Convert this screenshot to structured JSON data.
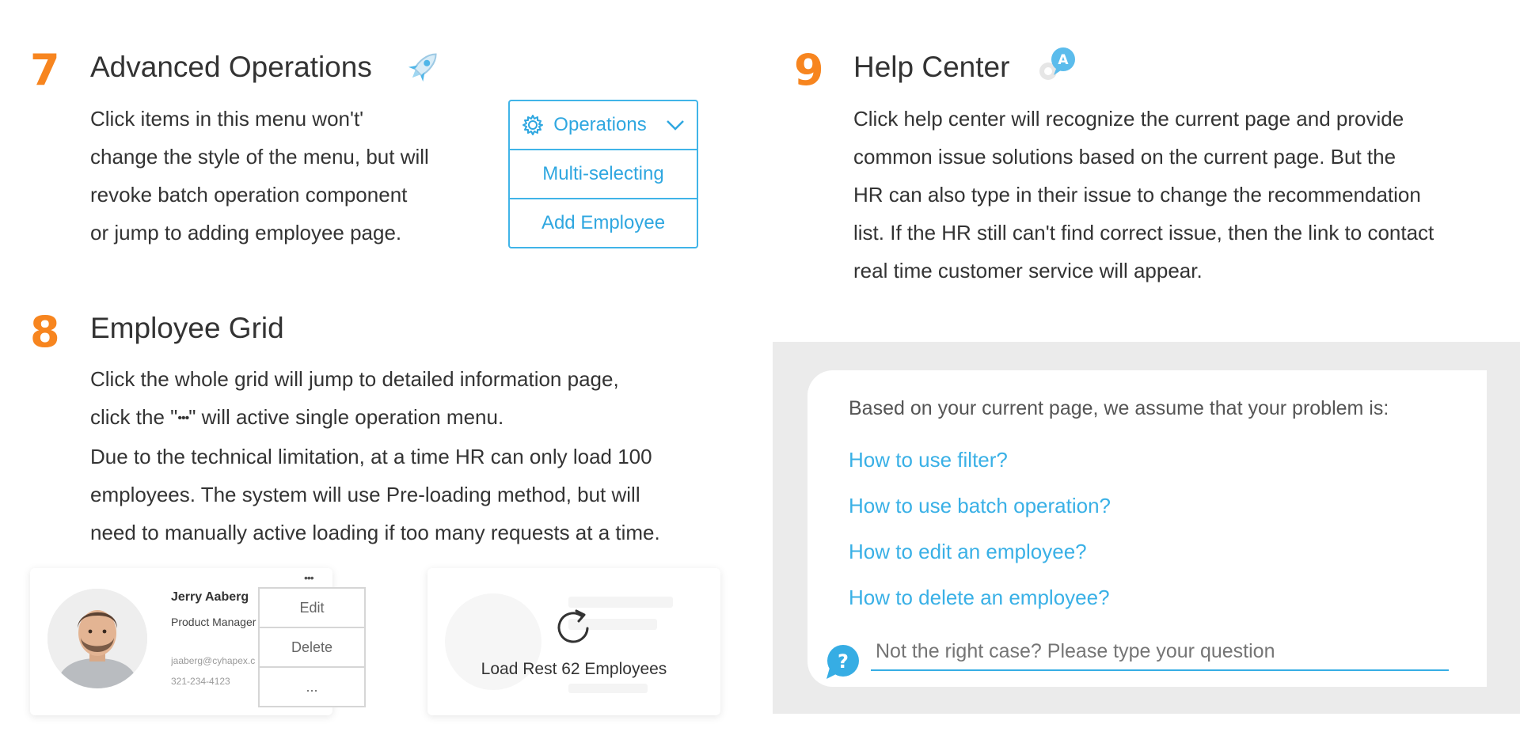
{
  "sections": {
    "advanced": {
      "number": "7",
      "title": "Advanced Operations",
      "lines": [
        "Click items in this menu won't'",
        "change the style of the menu, but will",
        "revoke batch operation component",
        "or jump to adding employee page."
      ],
      "menu": {
        "header": "Operations",
        "items": [
          "Multi-selecting",
          "Add Employee"
        ]
      }
    },
    "grid": {
      "number": "8",
      "title": "Employee Grid",
      "line1": "Click the whole grid will jump to detailed information page,",
      "line2_before": "click the \"",
      "line2_glyph": "•••",
      "line2_after": "\" will active single operation menu.",
      "lines_rest": [
        "Due to the technical limitation, at a time HR can only load 100",
        "employees. The system will use Pre-loading method, but will",
        "need to manually active loading if too many requests at a time."
      ],
      "employee": {
        "name": "Jerry Aaberg",
        "role": "Product Manager",
        "email": "jaaberg@cyhapex.c",
        "phone": "321-234-4123",
        "more": "•••",
        "menu": [
          "Edit",
          "Delete",
          "..."
        ]
      },
      "load_more": "Load Rest 62 Employees"
    },
    "help": {
      "number": "9",
      "title": "Help Center",
      "lines": [
        "Click help center will recognize the current page and provide",
        "common issue solutions based on the current page. But the",
        "HR can also type in their issue to change the recommendation",
        "list. If the HR still can't find correct issue, then the link to contact",
        "real time customer service will appear."
      ],
      "badge_letter": "A",
      "assume": "Based on your current page, we assume that your problem is:",
      "links": [
        "How to use filter?",
        "How to use batch operation?",
        "How to edit an employee?",
        "How to delete an employee?"
      ],
      "question_mark": "?",
      "placeholder": "Not the right case? Please type your question"
    }
  },
  "colors": {
    "accent_orange": "#f7851f",
    "link_blue": "#39b0e6",
    "border_blue": "#40b4e8",
    "text_dark": "#333333",
    "panel_gray": "#ebebeb"
  },
  "icons": [
    "rocket-icon",
    "gear-icon",
    "chevron-down-icon",
    "refresh-icon",
    "help-bubble-icon",
    "chat-badge-icon"
  ]
}
